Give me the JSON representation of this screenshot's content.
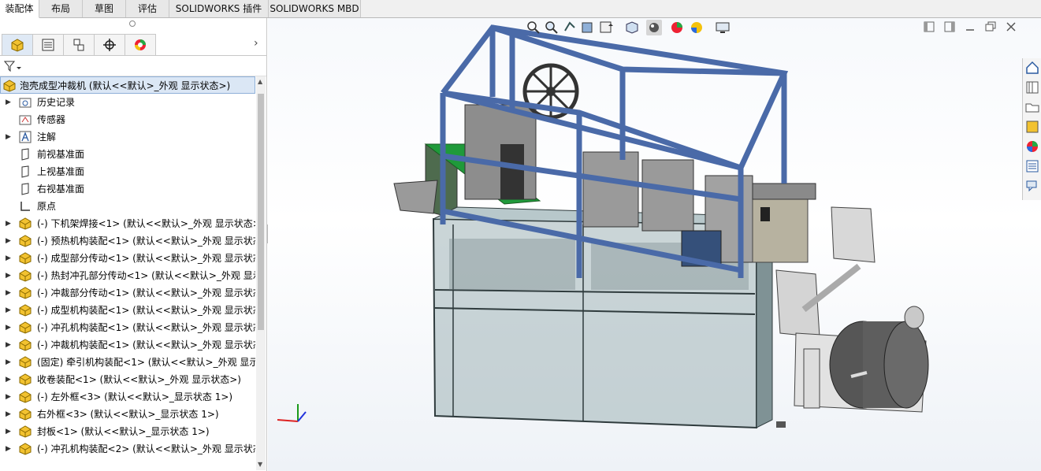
{
  "tabs": [
    "装配体",
    "布局",
    "草图",
    "评估",
    "SOLIDWORKS 插件",
    "SOLIDWORKS MBD"
  ],
  "feature_manager": {
    "panel_tabs": [
      "feature-manager-tab-icon",
      "property-manager-tab-icon",
      "configuration-manager-tab-icon",
      "dimxpert-tab-icon",
      "display-manager-tab-icon"
    ],
    "root": "泡壳成型冲裁机  (默认<<默认>_外观 显示状态>)",
    "items": [
      {
        "label": "历史记录",
        "icon": "history-folder-icon",
        "expand": true
      },
      {
        "label": "传感器",
        "icon": "sensor-folder-icon",
        "expand": false
      },
      {
        "label": "注解",
        "icon": "annotation-icon",
        "expand": true
      },
      {
        "label": "前视基准面",
        "icon": "plane-icon",
        "expand": false
      },
      {
        "label": "上视基准面",
        "icon": "plane-icon",
        "expand": false
      },
      {
        "label": "右视基准面",
        "icon": "plane-icon",
        "expand": false
      },
      {
        "label": "原点",
        "icon": "origin-icon",
        "expand": false
      },
      {
        "label": "(-) 下机架焊接<1> (默认<<默认>_外观 显示状态>",
        "icon": "subassembly-icon",
        "expand": true
      },
      {
        "label": "(-) 预热机构装配<1> (默认<<默认>_外观 显示状态",
        "icon": "subassembly-icon",
        "expand": true
      },
      {
        "label": "(-) 成型部分传动<1> (默认<<默认>_外观 显示状态",
        "icon": "subassembly-icon",
        "expand": true
      },
      {
        "label": "(-) 热封冲孔部分传动<1> (默认<<默认>_外观 显示",
        "icon": "subassembly-icon",
        "expand": true
      },
      {
        "label": "(-) 冲裁部分传动<1> (默认<<默认>_外观 显示状态",
        "icon": "subassembly-icon",
        "expand": true
      },
      {
        "label": "(-) 成型机构装配<1> (默认<<默认>_外观 显示状态",
        "icon": "subassembly-icon",
        "expand": true
      },
      {
        "label": "(-) 冲孔机构装配<1> (默认<<默认>_外观 显示状态",
        "icon": "subassembly-icon",
        "expand": true
      },
      {
        "label": "(-) 冲裁机构装配<1> (默认<<默认>_外观 显示状态",
        "icon": "subassembly-icon",
        "expand": true
      },
      {
        "label": "(固定) 牵引机构装配<1> (默认<<默认>_外观 显示状",
        "icon": "subassembly-icon",
        "expand": true
      },
      {
        "label": "收卷装配<1> (默认<<默认>_外观 显示状态>)",
        "icon": "subassembly-icon",
        "expand": true
      },
      {
        "label": "(-) 左外框<3> (默认<<默认>_显示状态 1>)",
        "icon": "subassembly-icon",
        "expand": true
      },
      {
        "label": "右外框<3> (默认<<默认>_显示状态 1>)",
        "icon": "subassembly-icon",
        "expand": true
      },
      {
        "label": "封板<1> (默认<<默认>_显示状态 1>)",
        "icon": "subassembly-icon",
        "expand": true
      },
      {
        "label": "(-) 冲孔机构装配<2> (默认<<默认>_外观 显示状态",
        "icon": "subassembly-icon",
        "expand": true
      }
    ]
  },
  "heads_up_toolbar": [
    "zoom-to-fit-icon",
    "zoom-to-area-icon",
    "previous-view-icon",
    "section-view-icon",
    "dynamic-annotation-icon",
    "view-orientation-icon",
    "display-style-icon",
    "hide-show-items-icon",
    "edit-appearance-icon",
    "apply-scene-icon",
    "view-settings-icon"
  ],
  "window_controls": [
    "tile-left-icon",
    "tile-right-icon",
    "minimize-icon",
    "restore-icon",
    "close-icon"
  ],
  "task_pane": [
    "solidworks-resources-icon",
    "design-library-icon",
    "file-explorer-icon",
    "view-palette-icon",
    "appearances-icon",
    "custom-properties-icon",
    "forum-icon"
  ],
  "colors": {
    "frame_blue": "#4a6aa8",
    "guard_glass": "#8fa3a8",
    "conveyor_green": "#1f9a3a",
    "selection": "#dbe7f5"
  }
}
